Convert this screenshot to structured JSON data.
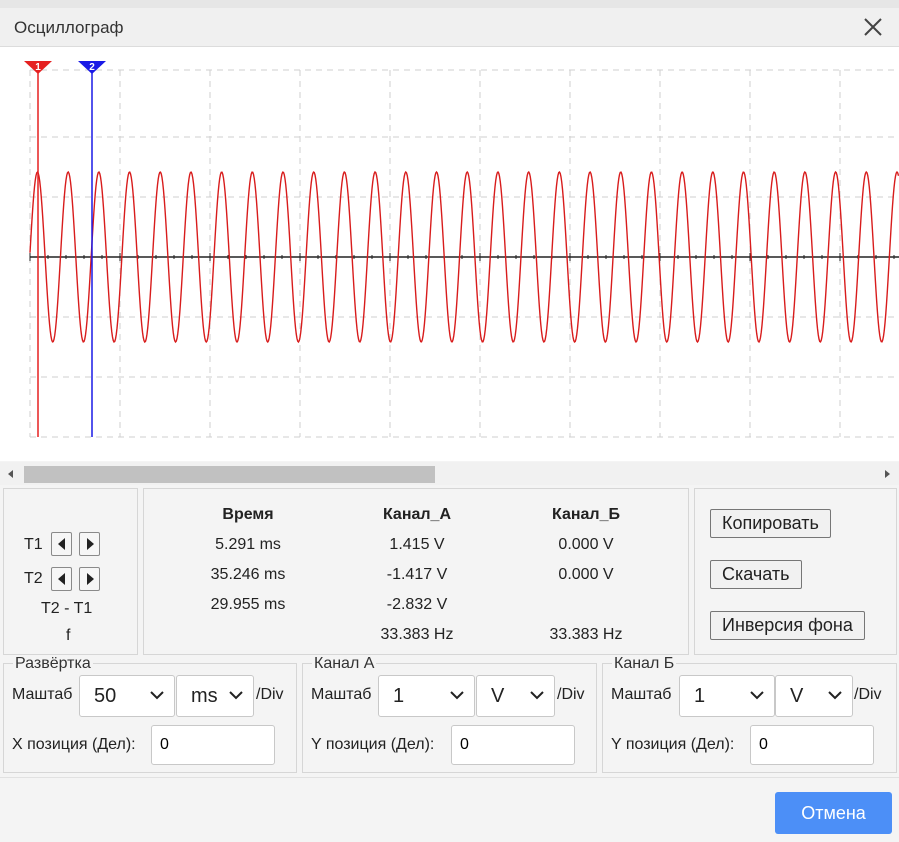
{
  "window": {
    "title": "Осциллограф"
  },
  "cursors": [
    {
      "id": "1",
      "color": "#e52121"
    },
    {
      "id": "2",
      "color": "#1a1ae6"
    }
  ],
  "trace_color": "#d81c1c",
  "axis_color": "#222222",
  "cursor_rows": [
    {
      "label": "T1"
    },
    {
      "label": "T2"
    },
    {
      "label": "T2 - T1"
    },
    {
      "label": "f"
    }
  ],
  "readout": {
    "headers": [
      "Время",
      "Канал_А",
      "Канал_Б"
    ],
    "rows": [
      [
        "5.291 ms",
        "1.415 V",
        "0.000 V"
      ],
      [
        "35.246 ms",
        "-1.417 V",
        "0.000 V"
      ],
      [
        "29.955 ms",
        "-2.832 V",
        ""
      ],
      [
        "",
        "33.383 Hz",
        "33.383 Hz"
      ]
    ]
  },
  "buttons": {
    "copy": "Копировать",
    "download": "Скачать",
    "invert": "Инверсия фона",
    "cancel": "Отмена"
  },
  "groups": [
    {
      "legend": "Развёртка",
      "scale_label": "Маштаб",
      "scale_value": "50",
      "unit_value": "ms",
      "per_div": "/Div",
      "pos_label": "X позиция (Дел):",
      "pos_value": "0"
    },
    {
      "legend": "Канал А",
      "scale_label": "Маштаб",
      "scale_value": "1",
      "unit_value": "V",
      "per_div": "/Div",
      "pos_label": "Y позиция (Дел):",
      "pos_value": "0"
    },
    {
      "legend": "Канал Б",
      "scale_label": "Маштаб",
      "scale_value": "1",
      "unit_value": "V",
      "per_div": "/Div",
      "pos_label": "Y позиция (Дел):",
      "pos_value": "0"
    }
  ]
}
